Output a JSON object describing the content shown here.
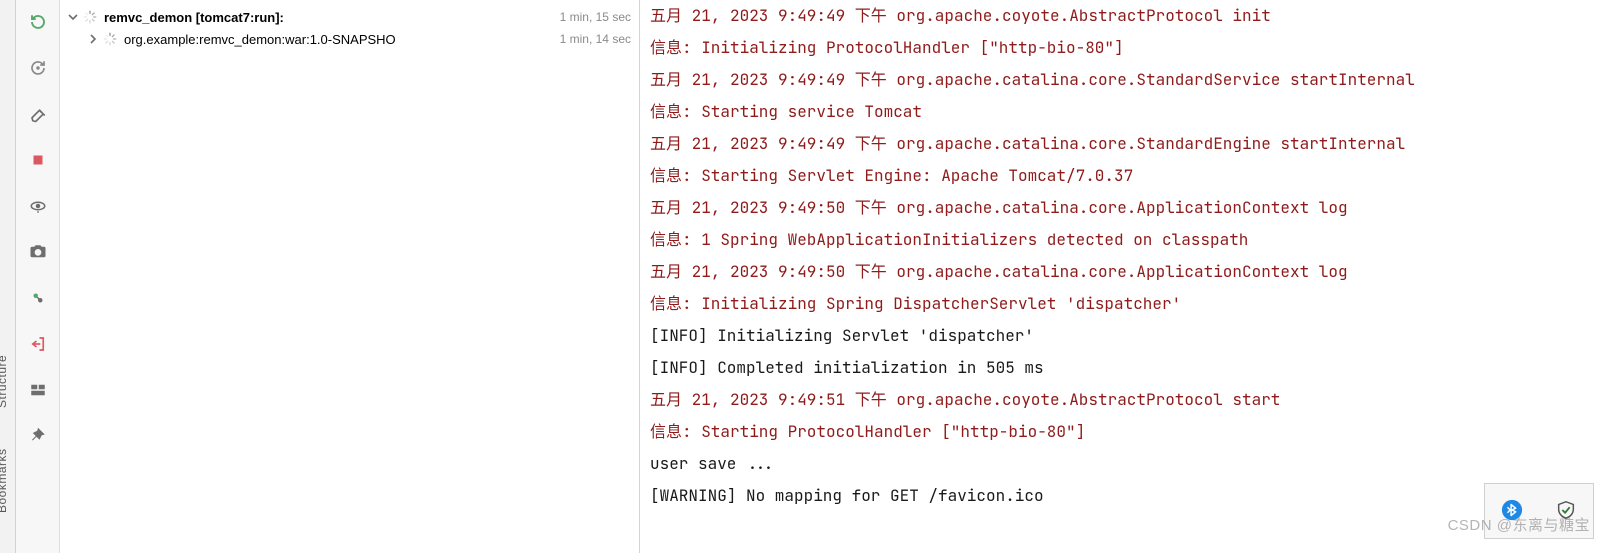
{
  "sidebar_vertical": {
    "label_structure": "Structure",
    "label_bookmarks": "Bookmarks"
  },
  "tree": {
    "root": {
      "label": "remvc_demon [tomcat7:run]:",
      "time": "1 min, 15 sec"
    },
    "child": {
      "label": "org.example:remvc_demon:war:1.0-SNAPSHO",
      "time": "1 min, 14 sec"
    }
  },
  "console_lines": [
    {
      "cls": "red",
      "text": "五月 21, 2023 9:49:49 下午 org.apache.coyote.AbstractProtocol init"
    },
    {
      "cls": "red",
      "text": "信息: Initializing ProtocolHandler [\"http-bio-80\"]"
    },
    {
      "cls": "red",
      "text": "五月 21, 2023 9:49:49 下午 org.apache.catalina.core.StandardService startInternal"
    },
    {
      "cls": "red",
      "text": "信息: Starting service Tomcat"
    },
    {
      "cls": "red",
      "text": "五月 21, 2023 9:49:49 下午 org.apache.catalina.core.StandardEngine startInternal"
    },
    {
      "cls": "red",
      "text": "信息: Starting Servlet Engine: Apache Tomcat/7.0.37"
    },
    {
      "cls": "red",
      "text": "五月 21, 2023 9:49:50 下午 org.apache.catalina.core.ApplicationContext log"
    },
    {
      "cls": "red",
      "text": "信息: 1 Spring WebApplicationInitializers detected on classpath"
    },
    {
      "cls": "red",
      "text": "五月 21, 2023 9:49:50 下午 org.apache.catalina.core.ApplicationContext log"
    },
    {
      "cls": "red",
      "text": "信息: Initializing Spring DispatcherServlet 'dispatcher'"
    },
    {
      "cls": "black",
      "text": "[INFO] Initializing Servlet 'dispatcher'"
    },
    {
      "cls": "black",
      "text": "[INFO] Completed initialization in 505 ms"
    },
    {
      "cls": "red",
      "text": "五月 21, 2023 9:49:51 下午 org.apache.coyote.AbstractProtocol start"
    },
    {
      "cls": "red",
      "text": "信息: Starting ProtocolHandler [\"http-bio-80\"]"
    },
    {
      "cls": "black",
      "text": "user save ..."
    },
    {
      "cls": "black",
      "text": "[WARNING] No mapping for GET /favicon.ico"
    }
  ],
  "watermark": "CSDN @东离与糖宝",
  "colors": {
    "green": "#59a869",
    "red_icon": "#db5860",
    "grey": "#6e6e6e"
  }
}
